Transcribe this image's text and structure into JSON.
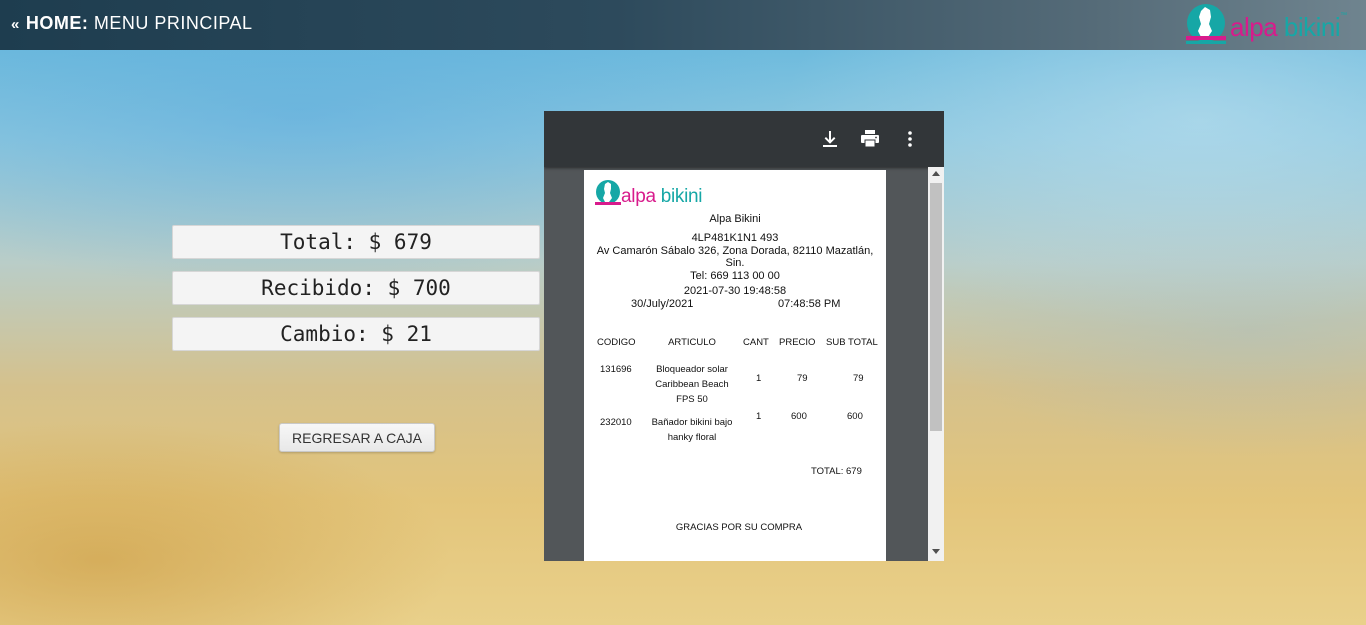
{
  "header": {
    "back_arrow": "«",
    "home_label": "HOME:",
    "menu_label": "MENU PRINCIPAL",
    "logo_word_1": "alpa",
    "logo_word_2": "bikini",
    "logo_tm": "™"
  },
  "summary": {
    "total": "Total: $ 679",
    "recibido": "Recibido: $ 700",
    "cambio": "Cambio: $ 21",
    "back_button": "REGRESAR A CAJA"
  },
  "viewer": {
    "icons": [
      "download-icon",
      "print-icon",
      "more-vert-icon"
    ]
  },
  "receipt": {
    "logo_word_1": "alpa",
    "logo_word_2": "bikini",
    "store_name": "Alpa Bikini",
    "rfc": "4LP481K1N1 493",
    "address_line1": "Av Camarón Sábalo 326, Zona Dorada, 82110 Mazatlán,",
    "address_line2": "Sin.",
    "phone": "Tel: 669 113 00 00",
    "timestamp": "2021-07-30 19:48:58",
    "date": "30/July/2021",
    "time": "07:48:58 PM",
    "columns": [
      "CODIGO",
      "ARTICULO",
      "CANT",
      "PRECIO",
      "SUB TOTAL"
    ],
    "items": [
      {
        "code": "131696",
        "article_l1": "Bloqueador solar",
        "article_l2": "Caribbean Beach",
        "article_l3": "FPS 50",
        "qty": "1",
        "price": "79",
        "subtotal": "79"
      },
      {
        "code": "232010",
        "article_l1": "Bañador bikini bajo",
        "article_l2": "hanky floral",
        "qty": "1",
        "price": "600",
        "subtotal": "600"
      }
    ],
    "total": "TOTAL: 679",
    "thanks": "GRACIAS POR SU COMPRA"
  },
  "colors": {
    "brand_pink": "#d81b8c",
    "brand_teal": "#16a7a6",
    "header_dark": "#1e3d4f"
  }
}
